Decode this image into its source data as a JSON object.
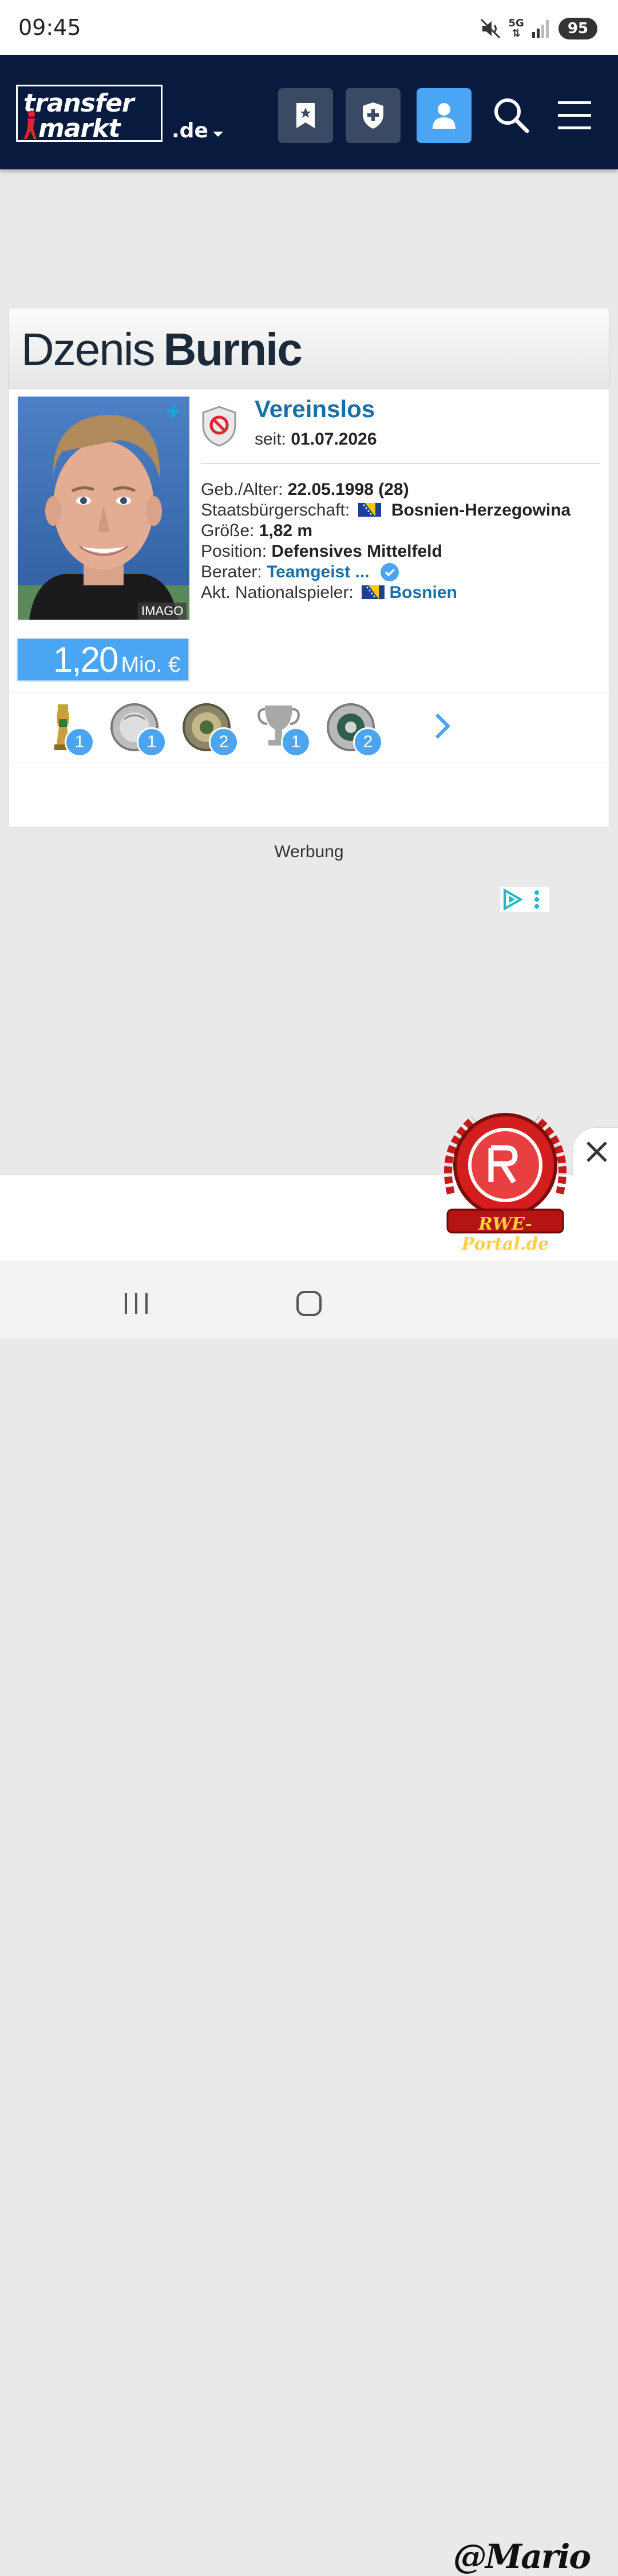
{
  "status_bar": {
    "time": "09:45",
    "network_top": "5G",
    "battery": "95"
  },
  "header": {
    "logo_line1": "transfer",
    "logo_line2": "markt",
    "domain": ".de",
    "icons": [
      "bookmark-star-icon",
      "shield-plus-icon",
      "user-icon",
      "search-icon",
      "menu-icon"
    ]
  },
  "player": {
    "first_name": "Dzenis",
    "last_name": "Burnic",
    "photo_credit": "IMAGO",
    "photo_plus": "+",
    "market_value": "1,20",
    "market_value_unit": "Mio. €",
    "club": "Vereinslos",
    "since_label": "seit:",
    "since_date": "01.07.2026",
    "info": [
      {
        "label": "Geb./Alter:",
        "value": "22.05.1998 (28)"
      },
      {
        "label": "Staatsbürgerschaft:",
        "value": "Bosnien-Herzegowina"
      },
      {
        "label": "Größe:",
        "value": "1,82 m"
      },
      {
        "label": "Position:",
        "value": "Defensives Mittelfeld"
      },
      {
        "label": "Berater:",
        "value": "Teamgeist ..."
      },
      {
        "label": "Akt. Nationalspieler:",
        "value": "Bosnien"
      }
    ]
  },
  "awards": [
    {
      "icon": "dfb-pokal-trophy-icon",
      "count": "1"
    },
    {
      "icon": "silver-plate-icon",
      "count": "1"
    },
    {
      "icon": "bronze-plate-icon",
      "count": "2"
    },
    {
      "icon": "silver-cup-icon",
      "count": "1"
    },
    {
      "icon": "medal-plate-icon",
      "count": "2"
    }
  ],
  "ad_label": "Werbung",
  "watermark_text": "RWE-Portal.de",
  "signature": "@Mario",
  "colors": {
    "nav_bg": "#081a3e",
    "accent_blue": "#4aa6f5",
    "link_blue": "#1a6fa6"
  }
}
